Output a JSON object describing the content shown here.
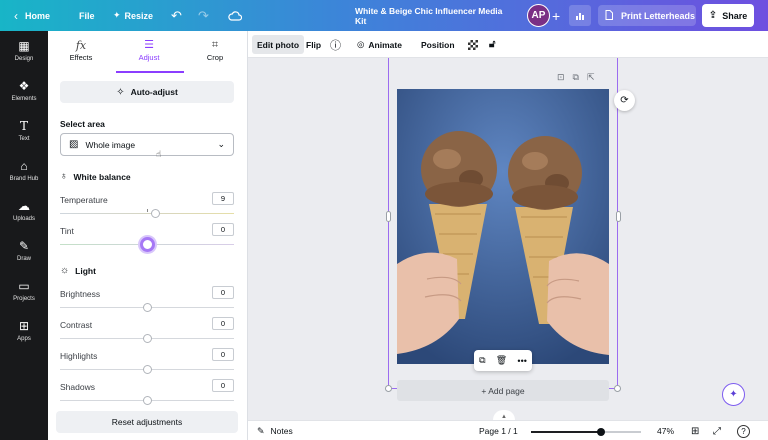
{
  "topbar": {
    "home_label": "Home",
    "file_label": "File",
    "resize_label": "Resize",
    "title": "White & Beige Chic Influencer Media Kit",
    "avatar_initials": "AP",
    "print_label": "Print Letterheads",
    "share_label": "Share"
  },
  "rail": {
    "items": [
      {
        "label": "Design",
        "icon": "layout-icon"
      },
      {
        "label": "Elements",
        "icon": "shapes-icon"
      },
      {
        "label": "Text",
        "icon": "text-icon"
      },
      {
        "label": "Brand Hub",
        "icon": "brand-icon"
      },
      {
        "label": "Uploads",
        "icon": "cloud-upload-icon"
      },
      {
        "label": "Draw",
        "icon": "pen-icon"
      },
      {
        "label": "Projects",
        "icon": "folder-icon"
      },
      {
        "label": "Apps",
        "icon": "apps-icon"
      }
    ]
  },
  "panel": {
    "tabs": [
      {
        "label": "Effects",
        "icon": "fx-icon"
      },
      {
        "label": "Adjust",
        "icon": "sliders-icon"
      },
      {
        "label": "Crop",
        "icon": "crop-icon"
      }
    ],
    "active_tab": "Adjust",
    "auto_adjust_label": "Auto-adjust",
    "select_area_label": "Select area",
    "select_area_value": "Whole image",
    "white_balance_label": "White balance",
    "light_label": "Light",
    "temperature": {
      "label": "Temperature",
      "value": "9",
      "position": 0.55
    },
    "tint": {
      "label": "Tint",
      "value": "0",
      "position": 0.5
    },
    "brightness": {
      "label": "Brightness",
      "value": "0",
      "position": 0.5
    },
    "contrast": {
      "label": "Contrast",
      "value": "0",
      "position": 0.5
    },
    "highlights": {
      "label": "Highlights",
      "value": "0",
      "position": 0.5
    },
    "shadows": {
      "label": "Shadows",
      "value": "0",
      "position": 0.5
    },
    "reset_label": "Reset adjustments"
  },
  "context_toolbar": {
    "edit_photo_label": "Edit photo",
    "flip_label": "Flip",
    "animate_label": "Animate",
    "position_label": "Position"
  },
  "canvas": {
    "add_page_label": "+ Add page"
  },
  "bottombar": {
    "notes_label": "Notes",
    "page_label": "Page 1 / 1",
    "zoom_label": "47%",
    "zoom_fraction": 0.47
  },
  "colors": {
    "accent": "#8b3dff",
    "rail_bg": "#18191b",
    "gradient_start": "#18b5c7",
    "gradient_end": "#6e4fe0"
  }
}
